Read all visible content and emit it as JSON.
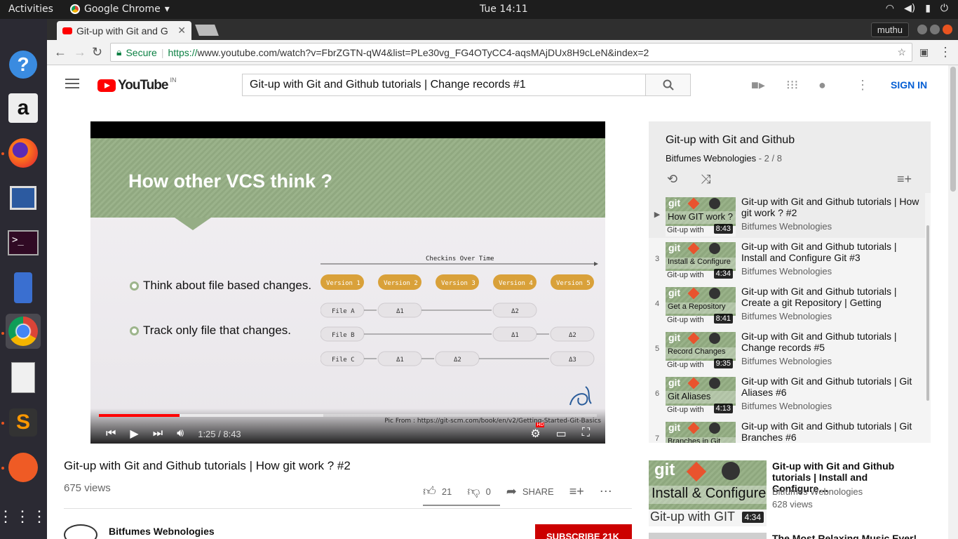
{
  "topbar": {
    "activities": "Activities",
    "app": "Google Chrome",
    "clock": "Tue 14:11"
  },
  "browser": {
    "tab_title": "Git-up with Git and G",
    "user": "muthu",
    "secure_label": "Secure",
    "url_scheme": "https://",
    "url_rest": "www.youtube.com/watch?v=FbrZGTN-qW4&list=PLe30vg_FG4OTyCC4-aqsMAjDUx8H9cLeN&index=2"
  },
  "youtube": {
    "logo_word": "YouTube",
    "country": "IN",
    "search_value": "Git-up with Git and Github tutorials | Change records #1",
    "signin": "SIGN IN"
  },
  "player": {
    "slide_heading": "How other VCS think ?",
    "bullet1": "Think about file based changes.",
    "bullet2": "Track only file that changes.",
    "diagram_header": "Checkins Over Time",
    "versions": [
      "Version 1",
      "Version 2",
      "Version 3",
      "Version 4",
      "Version 5"
    ],
    "files": [
      "File A",
      "File B",
      "File C"
    ],
    "deltas": {
      "a1": "Δ1",
      "a2": "Δ2",
      "b1": "Δ1",
      "b2": "Δ2",
      "c1": "Δ1",
      "c2": "Δ2",
      "c3": "Δ3"
    },
    "credit": "Pic From : https://git-scm.com/book/en/v2/Getting-Started-Git-Basics",
    "time": "1:25 / 8:43",
    "progress_fraction": 0.162,
    "hd_badge": "HD"
  },
  "video": {
    "title": "Git-up with Git and Github tutorials | How git work ? #2",
    "views": "675 views",
    "likes": "21",
    "dislikes": "0",
    "share": "SHARE",
    "channel": "Bitfumes Webnologies",
    "subscribe": "SUBSCRIBE  21K"
  },
  "playlist": {
    "title": "Git-up with Git and Github",
    "channel": "Bitfumes Webnologies",
    "position": " - 2 / 8",
    "items": [
      {
        "idx": "▶",
        "thumb_label": "How GIT work ?",
        "duration": "8:43",
        "title": "Git-up with Git and Github tutorials | How git work ? #2",
        "channel": "Bitfumes Webnologies"
      },
      {
        "idx": "3",
        "thumb_label": "Install & Configure",
        "duration": "4:34",
        "title": "Git-up with Git and Github tutorials | Install and Configure Git #3",
        "channel": "Bitfumes Webnologies"
      },
      {
        "idx": "4",
        "thumb_label": "Get a Repository",
        "duration": "8:41",
        "title": "Git-up with Git and Github tutorials | Create a git Repository | Getting",
        "channel": "Bitfumes Webnologies"
      },
      {
        "idx": "5",
        "thumb_label": "Record Changes",
        "duration": "9:35",
        "title": "Git-up with Git and Github tutorials | Change records #5",
        "channel": "Bitfumes Webnologies"
      },
      {
        "idx": "6",
        "thumb_label": "Git Aliases",
        "duration": "4:13",
        "title": "Git-up with Git and Github tutorials | Git Aliases #6",
        "channel": "Bitfumes Webnologies"
      },
      {
        "idx": "7",
        "thumb_label": "Branches in Git",
        "duration": "",
        "title": "Git-up with Git and Github tutorials | Git Branches #6",
        "channel": ""
      }
    ],
    "thumb_git": "git",
    "thumb_footer": "Git-up with"
  },
  "related": [
    {
      "thumb_label": "Install & Configure",
      "thumb_footer": "Git-up with GIT",
      "duration": "4:34",
      "title": "Git-up with Git and Github tutorials | Install and Configure…",
      "channel": "Bitfumes Webnologies",
      "views": "628 views"
    },
    {
      "title": "The Most Relaxing Music Ever!"
    }
  ]
}
